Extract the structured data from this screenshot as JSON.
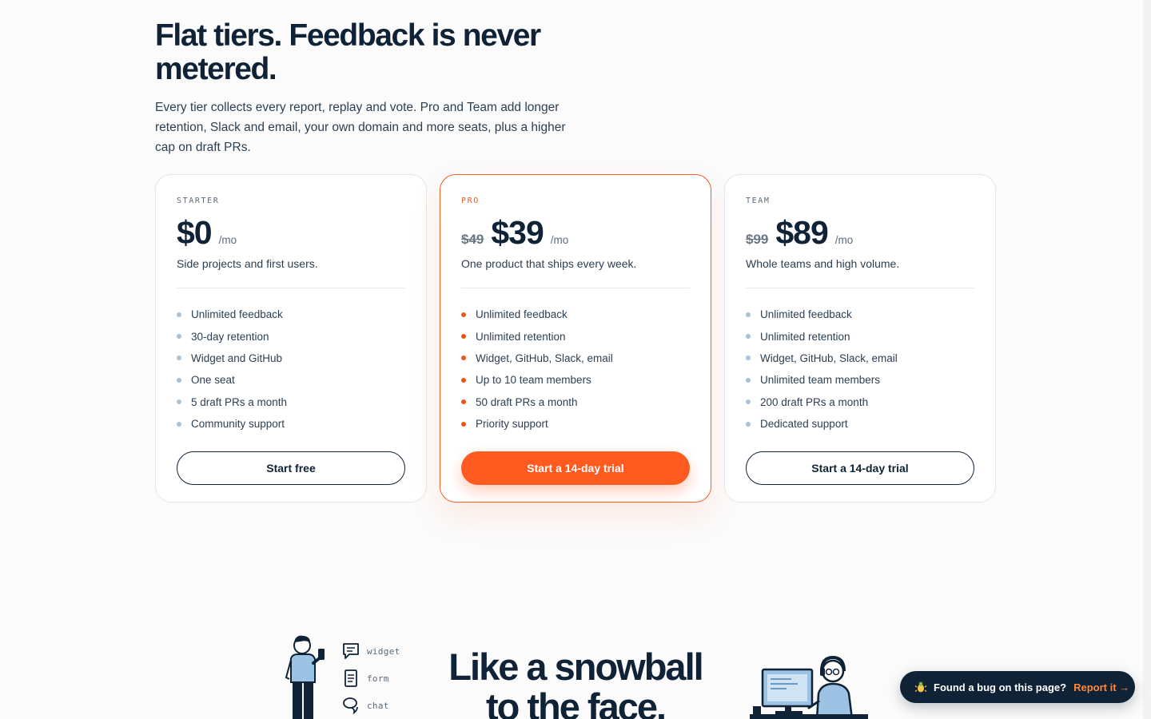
{
  "header": {
    "title": "Flat tiers. Feedback is never metered.",
    "subtitle": "Every tier collects every report, replay and vote. Pro and Team add longer retention, Slack and email, your own domain and more seats, plus a higher cap on draft PRs."
  },
  "plans": [
    {
      "tier": "STARTER",
      "old_price": "",
      "price": "$0",
      "per": "/mo",
      "description": "Side projects and first users.",
      "features": [
        "Unlimited feedback",
        "30-day retention",
        "Widget and GitHub",
        "One seat",
        "5 draft PRs a month",
        "Community support"
      ],
      "cta": "Start free"
    },
    {
      "tier": "PRO",
      "old_price": "$49",
      "price": "$39",
      "per": "/mo",
      "description": "One product that ships every week.",
      "features": [
        "Unlimited feedback",
        "Unlimited retention",
        "Widget, GitHub, Slack, email",
        "Up to 10 team members",
        "50 draft PRs a month",
        "Priority support"
      ],
      "cta": "Start a 14-day trial"
    },
    {
      "tier": "TEAM",
      "old_price": "$99",
      "price": "$89",
      "per": "/mo",
      "description": "Whole teams and high volume.",
      "features": [
        "Unlimited feedback",
        "Unlimited retention",
        "Widget, GitHub, Slack, email",
        "Unlimited team members",
        "200 draft PRs a month",
        "Dedicated support"
      ],
      "cta": "Start a 14-day trial"
    }
  ],
  "channels": [
    "widget",
    "form",
    "chat"
  ],
  "snowball": {
    "line1": "Like a snowball",
    "line2": "to the face."
  },
  "report_pill": {
    "icon": "bug-icon",
    "text": "Found a bug on this page?",
    "link": "Report it →"
  },
  "colors": {
    "accent": "#ff5a1f",
    "ink": "#0f2236",
    "muted": "#5a6b7c",
    "bullet": "#a8c2d6"
  }
}
